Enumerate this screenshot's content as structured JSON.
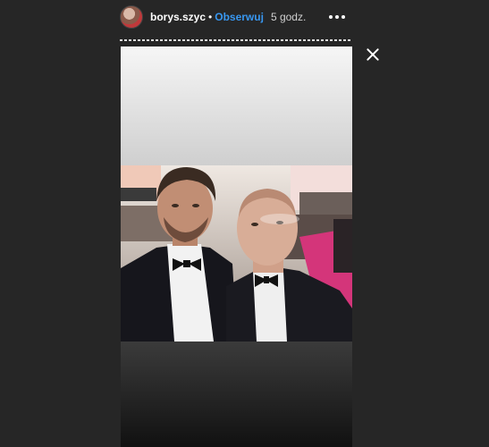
{
  "header": {
    "username": "borys.szyc",
    "separator": "•",
    "follow_label": "Obserwuj",
    "time": "5 godz."
  },
  "icons": {
    "avatar": "profile-avatar",
    "more": "more-horizontal-icon",
    "close": "close-icon"
  },
  "colors": {
    "background": "#262626",
    "follow": "#3897f0",
    "carpet": "#d4357a"
  }
}
